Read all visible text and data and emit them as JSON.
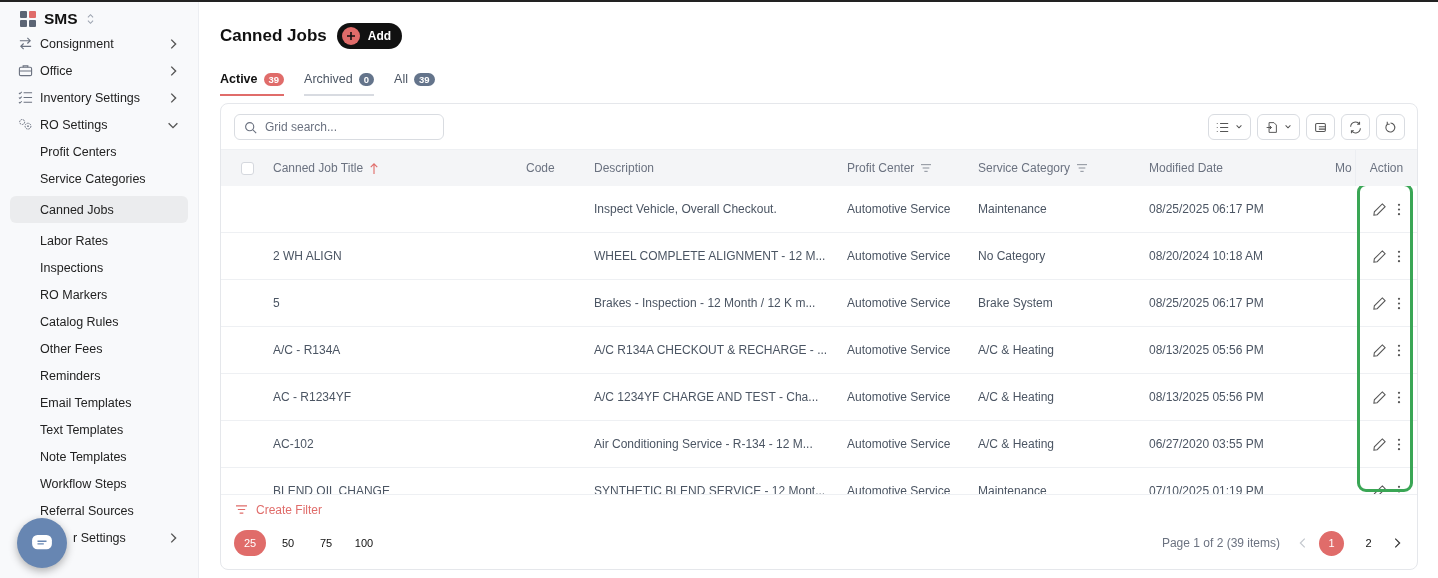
{
  "sidebar": {
    "brand": "SMS",
    "items": [
      {
        "label": "Consignment",
        "expanded": false
      },
      {
        "label": "Office",
        "expanded": false
      },
      {
        "label": "Inventory Settings",
        "expanded": false
      },
      {
        "label": "RO Settings",
        "expanded": true,
        "children": [
          {
            "label": "Profit Centers",
            "selected": false
          },
          {
            "label": "Service Categories",
            "selected": false
          },
          {
            "label": "Canned Jobs",
            "selected": true
          },
          {
            "label": "Labor Rates",
            "selected": false
          },
          {
            "label": "Inspections",
            "selected": false
          },
          {
            "label": "RO Markers",
            "selected": false
          },
          {
            "label": "Catalog Rules",
            "selected": false
          },
          {
            "label": "Other Fees",
            "selected": false
          },
          {
            "label": "Reminders",
            "selected": false
          },
          {
            "label": "Email Templates",
            "selected": false
          },
          {
            "label": "Text Templates",
            "selected": false
          },
          {
            "label": "Note Templates",
            "selected": false
          },
          {
            "label": "Workflow Steps",
            "selected": false
          },
          {
            "label": "Referral Sources",
            "selected": false
          }
        ]
      },
      {
        "label": "r Settings",
        "expanded": false
      }
    ]
  },
  "page": {
    "title": "Canned Jobs",
    "add_button": "Add"
  },
  "tabs": [
    {
      "label": "Active",
      "count": "39",
      "selected": true
    },
    {
      "label": "Archived",
      "count": "0",
      "selected": false
    },
    {
      "label": "All",
      "count": "39",
      "selected": false
    }
  ],
  "search": {
    "placeholder": "Grid search..."
  },
  "table": {
    "select_all": {
      "checked": false
    },
    "columns": [
      {
        "label": "Canned Job Title",
        "sorted": true,
        "filter": false
      },
      {
        "label": "Code",
        "sorted": false,
        "filter": false
      },
      {
        "label": "Description",
        "sorted": false,
        "filter": false
      },
      {
        "label": "Profit Center",
        "sorted": false,
        "filter": true
      },
      {
        "label": "Service Category",
        "sorted": false,
        "filter": true
      },
      {
        "label": "Modified Date",
        "sorted": false,
        "filter": false
      },
      {
        "label": "Mo",
        "sorted": false,
        "filter": false
      },
      {
        "label": "Action",
        "sorted": false,
        "filter": false
      }
    ],
    "rows": [
      {
        "title": "",
        "code": "",
        "description": "Inspect Vehicle, Overall Checkout.",
        "profit_center": "Automotive Service",
        "service_category": "Maintenance",
        "modified": "08/25/2025 06:17 PM"
      },
      {
        "title": "2 WH ALIGN",
        "code": "",
        "description": "WHEEL COMPLETE ALIGNMENT - 12 M...",
        "profit_center": "Automotive Service",
        "service_category": "No Category",
        "modified": "08/20/2024 10:18 AM"
      },
      {
        "title": "5",
        "code": "",
        "description": "Brakes - Inspection - 12 Month / 12 K m...",
        "profit_center": "Automotive Service",
        "service_category": "Brake System",
        "modified": "08/25/2025 06:17 PM"
      },
      {
        "title": "A/C - R134A",
        "code": "",
        "description": "A/C R134A CHECKOUT & RECHARGE - ...",
        "profit_center": "Automotive Service",
        "service_category": "A/C & Heating",
        "modified": "08/13/2025 05:56 PM"
      },
      {
        "title": "AC - R1234YF",
        "code": "",
        "description": "A/C 1234YF CHARGE AND TEST - Cha...",
        "profit_center": "Automotive Service",
        "service_category": "A/C & Heating",
        "modified": "08/13/2025 05:56 PM"
      },
      {
        "title": "AC-102",
        "code": "",
        "description": "Air Conditioning Service - R-134 - 12 M...",
        "profit_center": "Automotive Service",
        "service_category": "A/C & Heating",
        "modified": "06/27/2020 03:55 PM"
      },
      {
        "title": "BLEND OIL CHANGE",
        "code": "",
        "description": "SYNTHETIC BLEND SERVICE - 12 Mont...",
        "profit_center": "Automotive Service",
        "service_category": "Maintenance",
        "modified": "07/10/2025 01:19 PM"
      }
    ]
  },
  "create_filter": "Create Filter",
  "page_sizes": [
    {
      "label": "25",
      "selected": true
    },
    {
      "label": "50",
      "selected": false
    },
    {
      "label": "75",
      "selected": false
    },
    {
      "label": "100",
      "selected": false
    }
  ],
  "pagination": {
    "summary": "Page 1 of 2 (39 items)",
    "pages": [
      {
        "label": "1",
        "selected": true
      },
      {
        "label": "2",
        "selected": false
      }
    ]
  }
}
